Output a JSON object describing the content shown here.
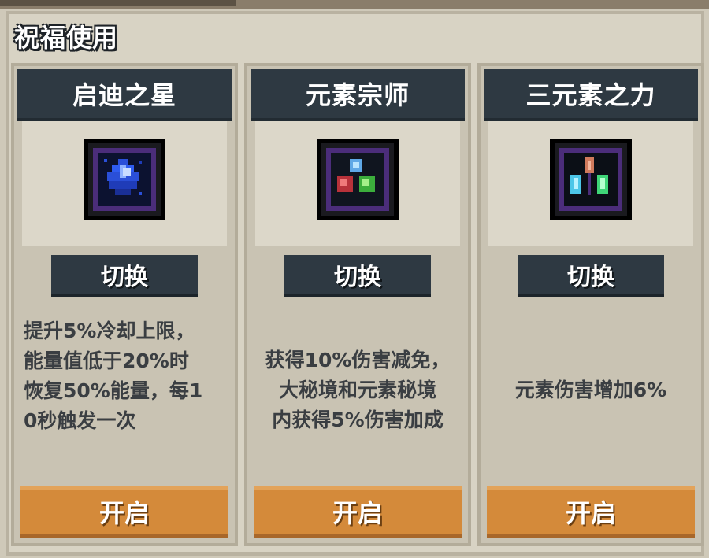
{
  "section": {
    "title": "祝福使用"
  },
  "cards": [
    {
      "name": "启迪之星",
      "icon": "blue-crystal-star-icon",
      "switch_label": "切换",
      "description": "提升5%冷却上限，\n能量值低于20%时\n恢复50%能量，每1\n0秒触发一次",
      "open_label": "开启"
    },
    {
      "name": "元素宗师",
      "icon": "three-element-orbs-icon",
      "switch_label": "切换",
      "description": "获得10%伤害减免，\n大秘境和元素秘境\n内获得5%伤害加成",
      "open_label": "开启"
    },
    {
      "name": "三元素之力",
      "icon": "three-element-crystals-icon",
      "switch_label": "切换",
      "description": "元素伤害增加6%",
      "open_label": "开启"
    }
  ],
  "colors": {
    "header_dark": "#2e3942",
    "button_orange": "#d48a3a",
    "panel_beige": "#d8d3c4",
    "text_dark": "#3a3e42"
  }
}
